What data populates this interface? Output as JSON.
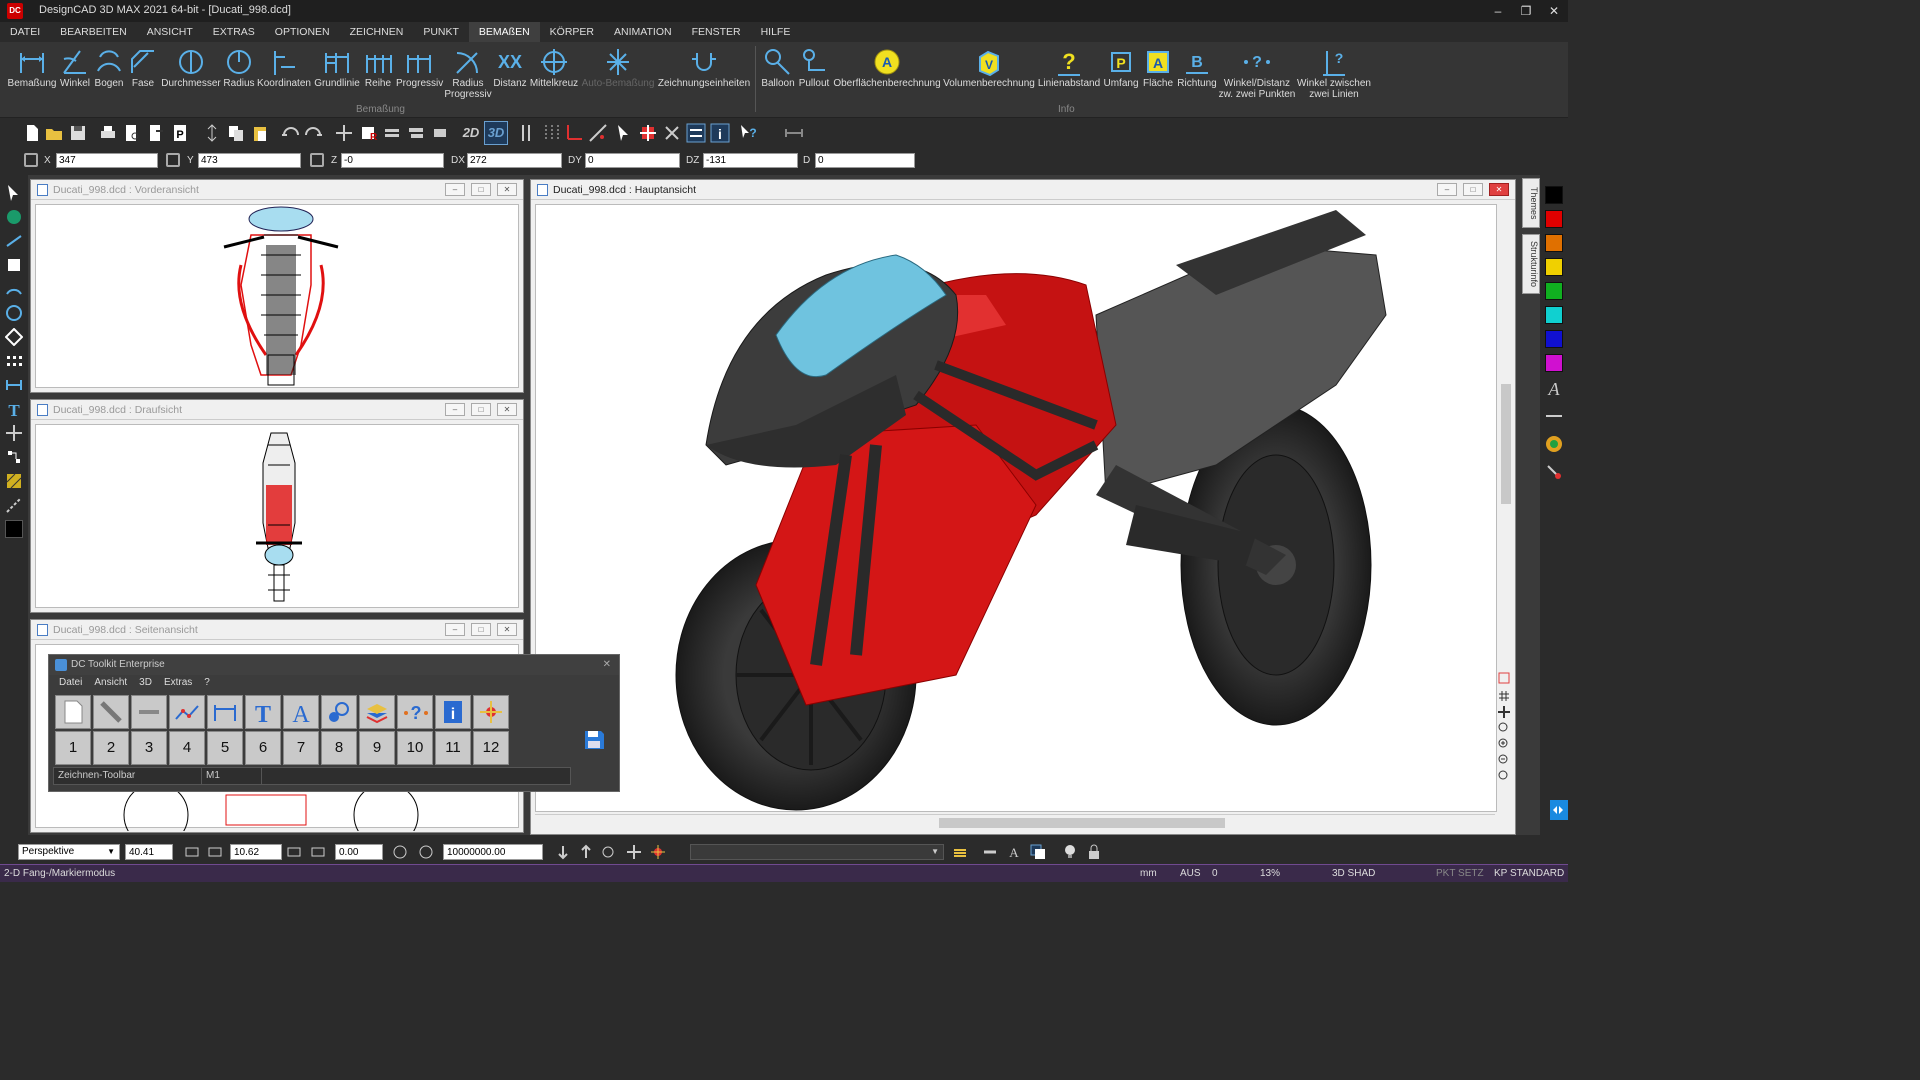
{
  "app": {
    "logo": "DC",
    "title": "DesignCAD 3D MAX 2021 64-bit - [Ducati_998.dcd]",
    "window_controls": [
      "minimize",
      "restore",
      "close"
    ]
  },
  "menu": [
    "DATEI",
    "BEARBEITEN",
    "ANSICHT",
    "EXTRAS",
    "OPTIONEN",
    "ZEICHNEN",
    "PUNKT",
    "BEMAßEN",
    "KÖRPER",
    "ANIMATION",
    "FENSTER",
    "HILFE"
  ],
  "menu_active": "BEMAßEN",
  "ribbon": {
    "bemassung": {
      "label": "Bemaßung",
      "buttons": [
        "Bemaßung",
        "Winkel",
        "Bogen",
        "Fase",
        "Durchmesser",
        "Radius",
        "Koordinaten",
        "Grundlinie",
        "Reihe",
        "Progressiv",
        "Radius Progressiv",
        "Distanz",
        "Mittelkreuz",
        "Auto-Bemaßung",
        "Zeichnungseinheiten"
      ]
    },
    "info": {
      "label": "Info",
      "buttons": [
        "Balloon",
        "Pullout",
        "Oberflächenberechnung",
        "Volumenberechnung",
        "Linienabstand",
        "Umfang",
        "Fläche",
        "Richtung",
        "Winkel/Distanz zw. zwei Punkten",
        "Winkel zwischen zwei Linien"
      ]
    }
  },
  "toolbar": {
    "mode_2d": "2D",
    "mode_3d": "3D"
  },
  "coords": {
    "x_label": "X",
    "x": "347",
    "y_label": "Y",
    "y": "473",
    "z_label": "Z",
    "z": "-0",
    "dx_label": "DX",
    "dx": "272",
    "dy_label": "DY",
    "dy": "0",
    "dz_label": "DZ",
    "dz": "-131",
    "d_label": "D",
    "d": "0"
  },
  "views": {
    "front": "Ducati_998.dcd : Vorderansicht",
    "top": "Ducati_998.dcd : Draufsicht",
    "side": "Ducati_998.dcd : Seitenansicht",
    "main": "Ducati_998.dcd : Hauptansicht"
  },
  "toolkit": {
    "title": "DC Toolkit Enterprise",
    "menu": [
      "Datei",
      "Ansicht",
      "3D",
      "Extras",
      "?"
    ],
    "numbers": [
      "1",
      "2",
      "3",
      "4",
      "5",
      "6",
      "7",
      "8",
      "9",
      "10",
      "11",
      "12"
    ],
    "status_left": "Zeichnen-Toolbar",
    "status_right": "M1"
  },
  "side_tabs": [
    "Themes",
    "Strukturinfo"
  ],
  "palette_colors": [
    "#000000",
    "#e00000",
    "#e07000",
    "#f0d000",
    "#10b020",
    "#10d0d0",
    "#1010d0",
    "#d010d0"
  ],
  "bottom": {
    "projection": "Perspektive",
    "val1": "40.41",
    "val2": "10.62",
    "val3": "0.00",
    "val4": "10000000.00"
  },
  "status": {
    "mode": "2-D Fang-/Markiermodus",
    "unit": "mm",
    "aus": "AUS",
    "zero": "0",
    "zoom": "13%",
    "shade": "3D SHAD",
    "pkt": "PKT SETZ",
    "kp": "KP STANDARD"
  }
}
